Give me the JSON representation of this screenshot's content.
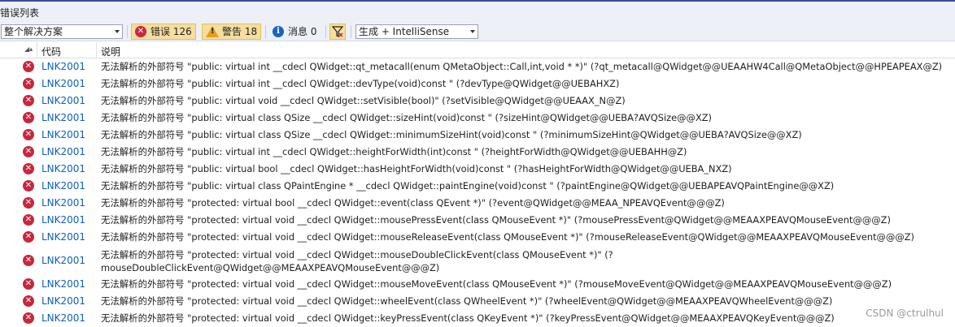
{
  "panel": {
    "title": "错误列表"
  },
  "toolbar": {
    "scope_value": "整个解决方案",
    "errors_label": "错误 126",
    "warnings_label": "警告 18",
    "messages_label": "消息 0",
    "build_filter_value": "生成 + IntelliSense"
  },
  "columns": {
    "code": "代码",
    "description": "说明"
  },
  "rows": [
    {
      "code": "LNK2001",
      "desc": "无法解析的外部符号 \"public: virtual int __cdecl QWidget::qt_metacall(enum QMetaObject::Call,int,void * *)\" (?qt_metacall@QWidget@@UEAAHW4Call@QMetaObject@@HPEAPEAX@Z)"
    },
    {
      "code": "LNK2001",
      "desc": "无法解析的外部符号 \"public: virtual int __cdecl QWidget::devType(void)const \" (?devType@QWidget@@UEBAHXZ)"
    },
    {
      "code": "LNK2001",
      "desc": "无法解析的外部符号 \"public: virtual void __cdecl QWidget::setVisible(bool)\" (?setVisible@QWidget@@UEAAX_N@Z)"
    },
    {
      "code": "LNK2001",
      "desc": "无法解析的外部符号 \"public: virtual class QSize __cdecl QWidget::sizeHint(void)const \" (?sizeHint@QWidget@@UEBA?AVQSize@@XZ)"
    },
    {
      "code": "LNK2001",
      "desc": "无法解析的外部符号 \"public: virtual class QSize __cdecl QWidget::minimumSizeHint(void)const \" (?minimumSizeHint@QWidget@@UEBA?AVQSize@@XZ)"
    },
    {
      "code": "LNK2001",
      "desc": "无法解析的外部符号 \"public: virtual int __cdecl QWidget::heightForWidth(int)const \" (?heightForWidth@QWidget@@UEBAHH@Z)"
    },
    {
      "code": "LNK2001",
      "desc": "无法解析的外部符号 \"public: virtual bool __cdecl QWidget::hasHeightForWidth(void)const \" (?hasHeightForWidth@QWidget@@UEBA_NXZ)"
    },
    {
      "code": "LNK2001",
      "desc": "无法解析的外部符号 \"public: virtual class QPaintEngine * __cdecl QWidget::paintEngine(void)const \" (?paintEngine@QWidget@@UEBAPEAVQPaintEngine@@XZ)"
    },
    {
      "code": "LNK2001",
      "desc": "无法解析的外部符号 \"protected: virtual bool __cdecl QWidget::event(class QEvent *)\" (?event@QWidget@@MEAA_NPEAVQEvent@@@Z)"
    },
    {
      "code": "LNK2001",
      "desc": "无法解析的外部符号 \"protected: virtual void __cdecl QWidget::mousePressEvent(class QMouseEvent *)\" (?mousePressEvent@QWidget@@MEAAXPEAVQMouseEvent@@@Z)"
    },
    {
      "code": "LNK2001",
      "desc": "无法解析的外部符号 \"protected: virtual void __cdecl QWidget::mouseReleaseEvent(class QMouseEvent *)\" (?mouseReleaseEvent@QWidget@@MEAAXPEAVQMouseEvent@@@Z)"
    },
    {
      "code": "LNK2001",
      "desc": "无法解析的外部符号 \"protected: virtual void __cdecl QWidget::mouseDoubleClickEvent(class QMouseEvent *)\" (?mouseDoubleClickEvent@QWidget@@MEAAXPEAVQMouseEvent@@@Z)"
    },
    {
      "code": "LNK2001",
      "desc": "无法解析的外部符号 \"protected: virtual void __cdecl QWidget::mouseMoveEvent(class QMouseEvent *)\" (?mouseMoveEvent@QWidget@@MEAAXPEAVQMouseEvent@@@Z)"
    },
    {
      "code": "LNK2001",
      "desc": "无法解析的外部符号 \"protected: virtual void __cdecl QWidget::wheelEvent(class QWheelEvent *)\" (?wheelEvent@QWidget@@MEAAXPEAVQWheelEvent@@@Z)"
    },
    {
      "code": "LNK2001",
      "desc": "无法解析的外部符号 \"protected: virtual void __cdecl QWidget::keyPressEvent(class QKeyEvent *)\" (?keyPressEvent@QWidget@@MEAAXPEAVQKeyEvent@@@Z)"
    }
  ],
  "watermark": "CSDN @ctrulhul",
  "colors": {
    "error": "#c6283d",
    "link": "#0e60b8",
    "accent_border": "#3f4b9e"
  }
}
